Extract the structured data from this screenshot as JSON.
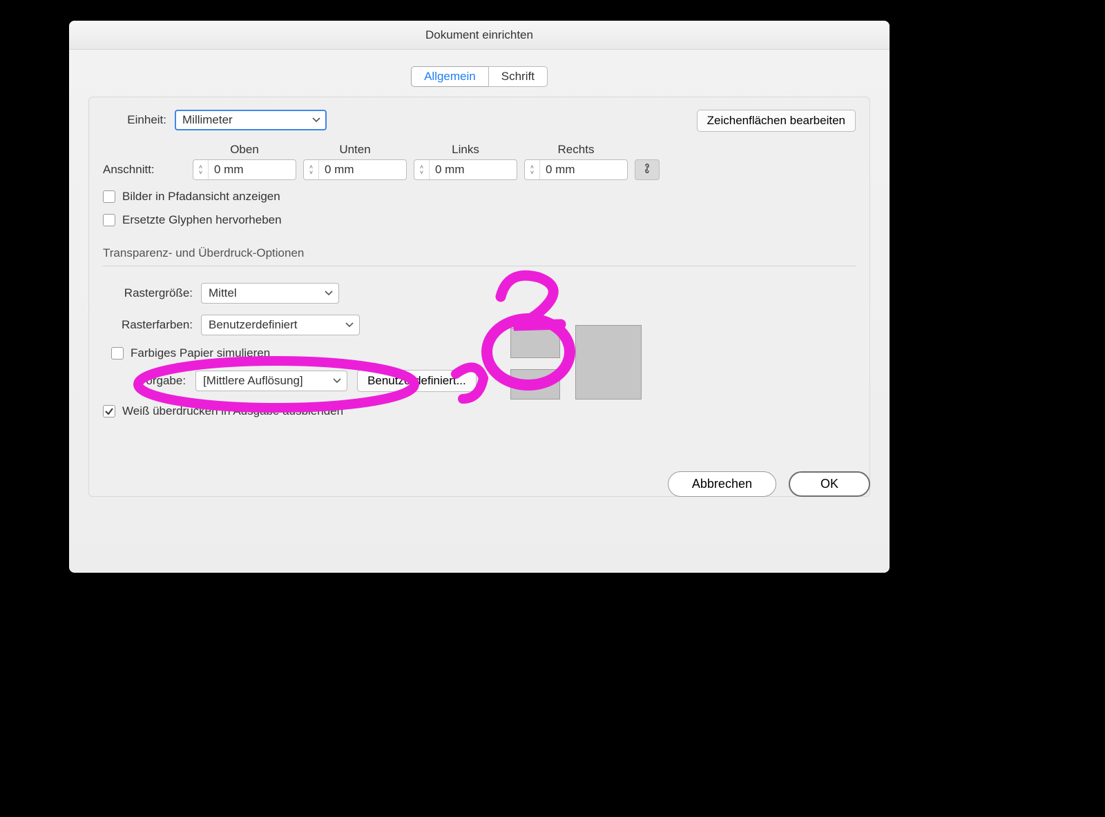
{
  "dialog": {
    "title": "Dokument einrichten",
    "tabs": {
      "general": "Allgemein",
      "type": "Schrift"
    }
  },
  "unit": {
    "label": "Einheit:",
    "value": "Millimeter"
  },
  "edit_artboards": "Zeichenflächen bearbeiten",
  "bleed": {
    "label": "Anschnitt:",
    "top_label": "Oben",
    "bottom_label": "Unten",
    "left_label": "Links",
    "right_label": "Rechts",
    "top": "0 mm",
    "bottom": "0 mm",
    "left": "0 mm",
    "right": "0 mm",
    "link_icon": "link-icon"
  },
  "show_images": "Bilder in Pfadansicht anzeigen",
  "highlight_glyphs": "Ersetzte Glyphen hervorheben",
  "section_transparency": "Transparenz- und Überdruck-Optionen",
  "grid_size": {
    "label": "Rastergröße:",
    "value": "Mittel"
  },
  "grid_colors": {
    "label": "Rasterfarben:",
    "value": "Benutzerdefiniert"
  },
  "simulate_paper": "Farbiges Papier simulieren",
  "preset": {
    "label": "Vorgabe:",
    "value": "[Mittlere Auflösung]",
    "custom_btn": "Benutzerdefiniert..."
  },
  "overprint_white": "Weiß überdrucken in Ausgabe ausblenden",
  "actions": {
    "cancel": "Abbrechen",
    "ok": "OK"
  },
  "annotations": {
    "one": "1",
    "two": "2"
  }
}
